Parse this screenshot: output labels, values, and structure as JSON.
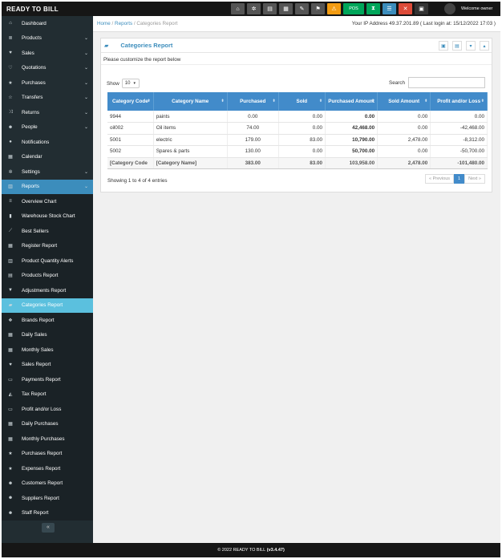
{
  "app": {
    "brand": "READY TO BILL",
    "welcome": "Welcome owner"
  },
  "toolbar": {
    "pos_label": "POS"
  },
  "sidebar": {
    "items": [
      {
        "label": "Dashboard",
        "icon": "dashboard-icon",
        "glyph": "⌂",
        "chev": ""
      },
      {
        "label": "Products",
        "icon": "list-icon",
        "glyph": "≣",
        "chev": "⌄"
      },
      {
        "label": "Sales",
        "icon": "heart-icon",
        "glyph": "♥",
        "chev": "⌄"
      },
      {
        "label": "Quotations",
        "icon": "heart-outline-icon",
        "glyph": "♡",
        "chev": "⌄"
      },
      {
        "label": "Purchases",
        "icon": "star-icon",
        "glyph": "★",
        "chev": "⌄"
      },
      {
        "label": "Transfers",
        "icon": "star-outline-icon",
        "glyph": "☆",
        "chev": "⌄"
      },
      {
        "label": "Returns",
        "icon": "random-icon",
        "glyph": "⤨",
        "chev": "⌄"
      },
      {
        "label": "People",
        "icon": "users-icon",
        "glyph": "☻",
        "chev": "⌄"
      },
      {
        "label": "Notifications",
        "icon": "info-icon",
        "glyph": "●",
        "chev": ""
      },
      {
        "label": "Calendar",
        "icon": "calendar-icon",
        "glyph": "▦",
        "chev": ""
      },
      {
        "label": "Settings",
        "icon": "cog-icon",
        "glyph": "✲",
        "chev": "⌄"
      },
      {
        "label": "Reports",
        "icon": "chart-icon",
        "glyph": "▥",
        "chev": "⌄"
      }
    ],
    "reports_sub": [
      {
        "label": "Overview Chart",
        "icon": "bars-icon",
        "glyph": "≡"
      },
      {
        "label": "Warehouse Stock Chart",
        "icon": "building-icon",
        "glyph": "▮"
      },
      {
        "label": "Best Sellers",
        "icon": "line-chart-icon",
        "glyph": "⟋"
      },
      {
        "label": "Register Report",
        "icon": "th-icon",
        "glyph": "▦"
      },
      {
        "label": "Product Quantity Alerts",
        "icon": "bar-chart-icon",
        "glyph": "▥"
      },
      {
        "label": "Products Report",
        "icon": "barcode-icon",
        "glyph": "▤"
      },
      {
        "label": "Adjustments Report",
        "icon": "filter-icon",
        "glyph": "▼"
      },
      {
        "label": "Categories Report",
        "icon": "folder-open-icon",
        "glyph": "▰"
      },
      {
        "label": "Brands Report",
        "icon": "cubes-icon",
        "glyph": "❖"
      },
      {
        "label": "Daily Sales",
        "icon": "calendar-icon",
        "glyph": "▦"
      },
      {
        "label": "Monthly Sales",
        "icon": "calendar-icon",
        "glyph": "▦"
      },
      {
        "label": "Sales Report",
        "icon": "heart-icon",
        "glyph": "♥"
      },
      {
        "label": "Payments Report",
        "icon": "money-icon",
        "glyph": "▭"
      },
      {
        "label": "Tax Report",
        "icon": "area-chart-icon",
        "glyph": "◭"
      },
      {
        "label": "Profit and/or Loss",
        "icon": "money-icon",
        "glyph": "▭"
      },
      {
        "label": "Daily Purchases",
        "icon": "calendar-icon",
        "glyph": "▦"
      },
      {
        "label": "Monthly Purchases",
        "icon": "calendar-icon",
        "glyph": "▦"
      },
      {
        "label": "Purchases Report",
        "icon": "star-icon",
        "glyph": "★"
      },
      {
        "label": "Expenses Report",
        "icon": "star-icon",
        "glyph": "★"
      },
      {
        "label": "Customers Report",
        "icon": "users-icon",
        "glyph": "☻"
      },
      {
        "label": "Suppliers Report",
        "icon": "users-icon",
        "glyph": "☻"
      },
      {
        "label": "Staff Report",
        "icon": "users-icon",
        "glyph": "☻"
      }
    ],
    "collapse_glyph": "«"
  },
  "breadcrumb": {
    "home": "Home",
    "reports": "Reports",
    "current": "Categories Report"
  },
  "ip_info": "Your IP Address 49.37.201.89 ( Last login at: 15/12/2022 17:03 )",
  "box": {
    "title": "Categories Report",
    "intro": "Please customize the report below",
    "show_label": "Show",
    "length_value": "10",
    "search_label": "Search"
  },
  "table": {
    "headers": [
      "Category Code",
      "Category Name",
      "Purchased",
      "Sold",
      "Purchased Amount",
      "Sold Amount",
      "Profit and/or Loss"
    ],
    "rows": [
      [
        "9944",
        "paints",
        "0.00",
        "0.00",
        "0.00",
        "0.00",
        "0.00"
      ],
      [
        "oil002",
        "Oil items",
        "74.00",
        "0.00",
        "42,468.00",
        "0.00",
        "-42,468.00"
      ],
      [
        "5001",
        "electric",
        "179.00",
        "83.00",
        "10,790.00",
        "2,478.00",
        "-8,312.00"
      ],
      [
        "5002",
        "Spares & parts",
        "130.00",
        "0.00",
        "50,700.00",
        "0.00",
        "-50,700.00"
      ]
    ],
    "footer": [
      "[Category Code",
      "[Category Name]",
      "383.00",
      "83.00",
      "103,958.00",
      "2,478.00",
      "-101,480.00"
    ]
  },
  "info_text": "Showing 1 to 4 of 4 entries",
  "pagination": {
    "previous": "« Previous",
    "page": "1",
    "next": "Next »"
  },
  "footer": {
    "copyright": "© 2022 READY TO BILL",
    "version": "(v3.4.47)"
  }
}
